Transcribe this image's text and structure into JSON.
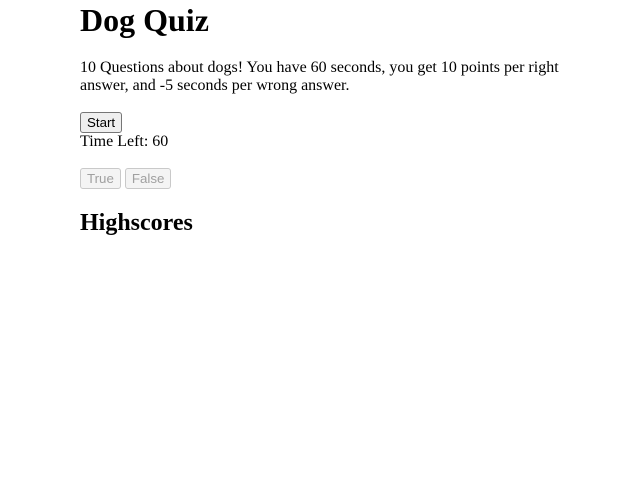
{
  "quiz": {
    "title": "Dog Quiz",
    "intro": "10 Questions about dogs! You have 60 seconds, you get 10 points per right answer, and -5 seconds per wrong answer.",
    "start_label": "Start",
    "timer_label": "Time Left: ",
    "timer_value": "60",
    "answers": {
      "true_label": "True",
      "false_label": "False"
    },
    "highscores_title": "Highscores"
  }
}
